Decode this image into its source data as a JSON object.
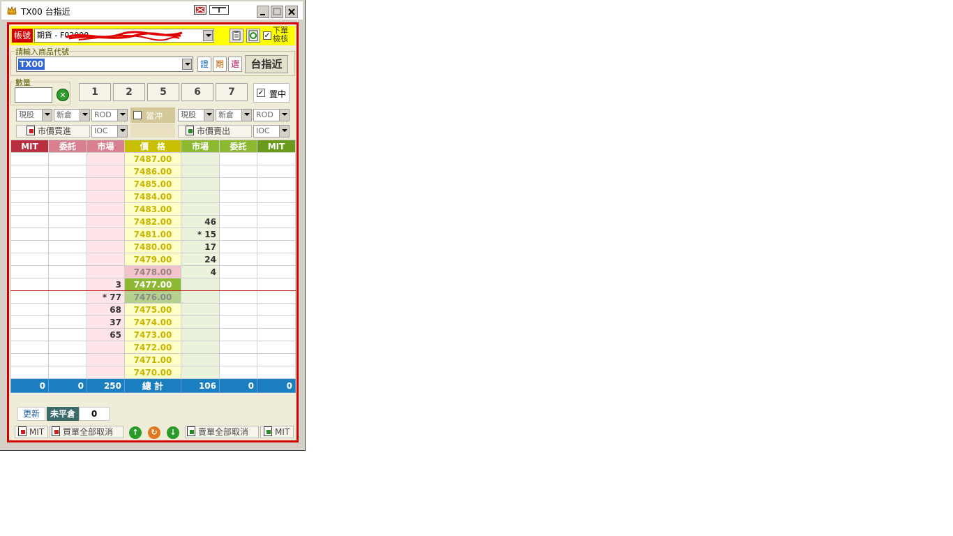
{
  "window": {
    "title": "TX00 台指近"
  },
  "account": {
    "label": "帳號",
    "value": "期貨 - F02000",
    "check_label_1": "下單",
    "check_label_2": "檢核",
    "checked": true
  },
  "product": {
    "group_title": "請輸入商品代號",
    "code": "TX00",
    "btn_stock": "證",
    "btn_futures": "期",
    "btn_options": "選",
    "product_name": "台指近"
  },
  "quantity": {
    "group_title": "數量",
    "value": "",
    "presets": [
      "1",
      "2",
      "5",
      "6",
      "7"
    ],
    "center_label": "置中",
    "center_checked": true
  },
  "order_options": {
    "buy": {
      "type": "現股",
      "position": "新倉",
      "tif": "ROD",
      "market_tif": "IOC",
      "market_label": "市價買進"
    },
    "daytrade_label": "當沖",
    "sell": {
      "type": "現股",
      "position": "新倉",
      "tif": "ROD",
      "market_tif": "IOC",
      "market_label": "市價賣出"
    }
  },
  "grid": {
    "headers": [
      "MIT",
      "委託",
      "市場",
      "價　格",
      "市場",
      "委託",
      "MIT"
    ],
    "header_colors": [
      "#b83040",
      "#d88090",
      "#d88090",
      "#c8c000",
      "#8cb832",
      "#8cb832",
      "#6a9a1a"
    ],
    "rows": [
      {
        "price": "7487.00",
        "bid": "",
        "ask": ""
      },
      {
        "price": "7486.00",
        "bid": "",
        "ask": ""
      },
      {
        "price": "7485.00",
        "bid": "",
        "ask": ""
      },
      {
        "price": "7484.00",
        "bid": "",
        "ask": ""
      },
      {
        "price": "7483.00",
        "bid": "",
        "ask": ""
      },
      {
        "price": "7482.00",
        "bid": "",
        "ask": "46"
      },
      {
        "price": "7481.00",
        "bid": "",
        "ask": "* 15"
      },
      {
        "price": "7480.00",
        "bid": "",
        "ask": "17"
      },
      {
        "price": "7479.00",
        "bid": "",
        "ask": "24"
      },
      {
        "price": "7478.00",
        "bid": "",
        "ask": "4"
      },
      {
        "price": "7477.00",
        "bid": "3",
        "ask": ""
      },
      {
        "price": "7476.00",
        "bid": "* 77",
        "ask": ""
      },
      {
        "price": "7475.00",
        "bid": "68",
        "ask": ""
      },
      {
        "price": "7474.00",
        "bid": "37",
        "ask": ""
      },
      {
        "price": "7473.00",
        "bid": "65",
        "ask": ""
      },
      {
        "price": "7472.00",
        "bid": "",
        "ask": ""
      },
      {
        "price": "7471.00",
        "bid": "",
        "ask": ""
      },
      {
        "price": "7470.00",
        "bid": "",
        "ask": ""
      }
    ],
    "totals": {
      "buy_mit": "0",
      "buy_order": "0",
      "buy_market": "250",
      "label": "總 計",
      "sell_market": "106",
      "sell_order": "0",
      "sell_mit": "0"
    }
  },
  "footer": {
    "refresh_label": "更新",
    "open_pos_label": "未平倉",
    "open_pos_value": "0",
    "buy_mit_label": "MIT",
    "buy_cancel_all_label": "買單全部取消",
    "sell_cancel_all_label": "賣單全部取消",
    "sell_mit_label": "MIT"
  }
}
